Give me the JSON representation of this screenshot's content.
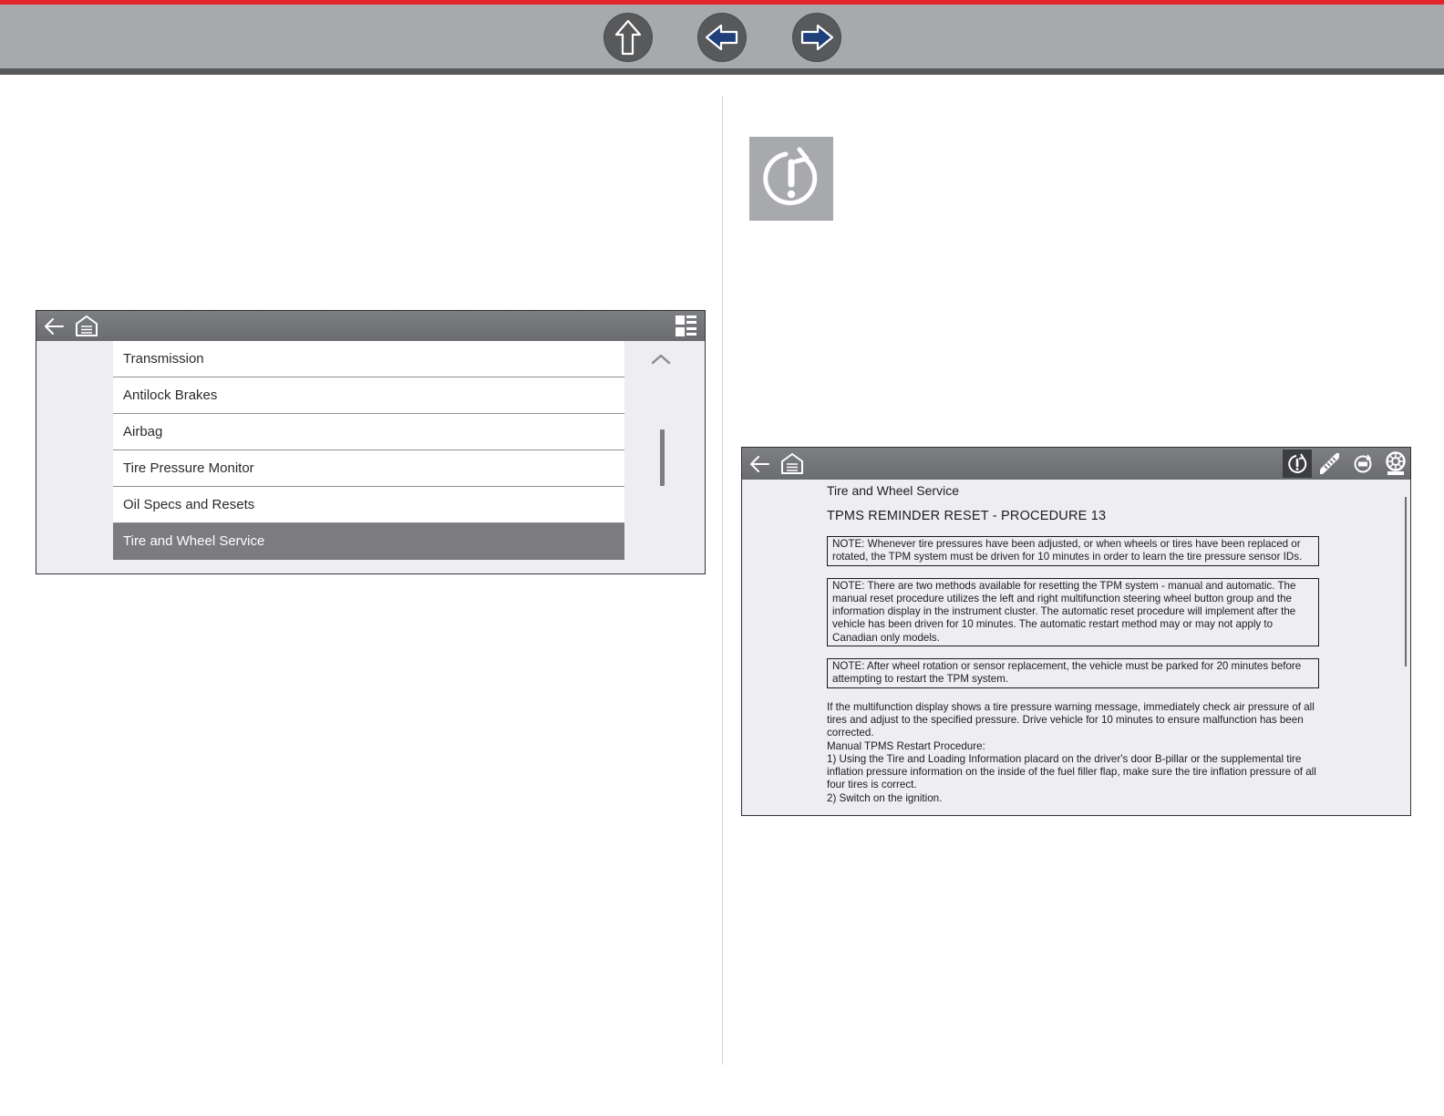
{
  "topnav": {
    "buttons": [
      "up-arrow-icon",
      "left-arrow-icon",
      "right-arrow-icon"
    ],
    "accent_color": "#e2232a",
    "bar_color": "#a7a9ac"
  },
  "menu": {
    "items": [
      {
        "label": "Transmission"
      },
      {
        "label": "Antilock Brakes"
      },
      {
        "label": "Airbag"
      },
      {
        "label": "Tire Pressure Monitor"
      },
      {
        "label": "Oil Specs and Resets"
      },
      {
        "label": "Tire and Wheel Service",
        "selected": true
      }
    ],
    "scroll_position": 0.75
  },
  "document": {
    "section": "Tire and Wheel Service",
    "title": "TPMS REMINDER RESET - PROCEDURE 13",
    "notes": [
      "NOTE: Whenever tire pressures have been adjusted, or when wheels or tires have been replaced or rotated, the TPM system must be driven for 10 minutes in order to learn the tire pressure sensor IDs.",
      "NOTE: There are two methods available for resetting the TPM system - manual and automatic. The manual reset procedure utilizes the left and right multifunction steering wheel button group and the information display in the instrument cluster. The automatic reset procedure will implement after the vehicle has been driven for 10 minutes. The automatic restart method may or may not apply to Canadian only models.",
      "NOTE: After wheel rotation or sensor replacement, the vehicle must be parked for 20 minutes before attempting to restart the TPM system."
    ],
    "body": [
      "If the multifunction display shows a tire pressure warning message, immediately check air pressure of all tires and adjust to the specified pressure. Drive vehicle for 10 minutes to ensure malfunction has been corrected.",
      "Manual TPMS Restart Procedure:",
      "1) Using the Tire and Loading Information placard on the driver's door B-pillar or the supplemental tire inflation pressure information on the inside of the fuel filler flap, make sure the tire inflation pressure of all four tires is correct.",
      "2) Switch on the ignition."
    ],
    "toolbar_icons": [
      "tpms-reset-icon",
      "tire-tread-icon",
      "tire-pressure-icon",
      "wheel-icon"
    ]
  }
}
